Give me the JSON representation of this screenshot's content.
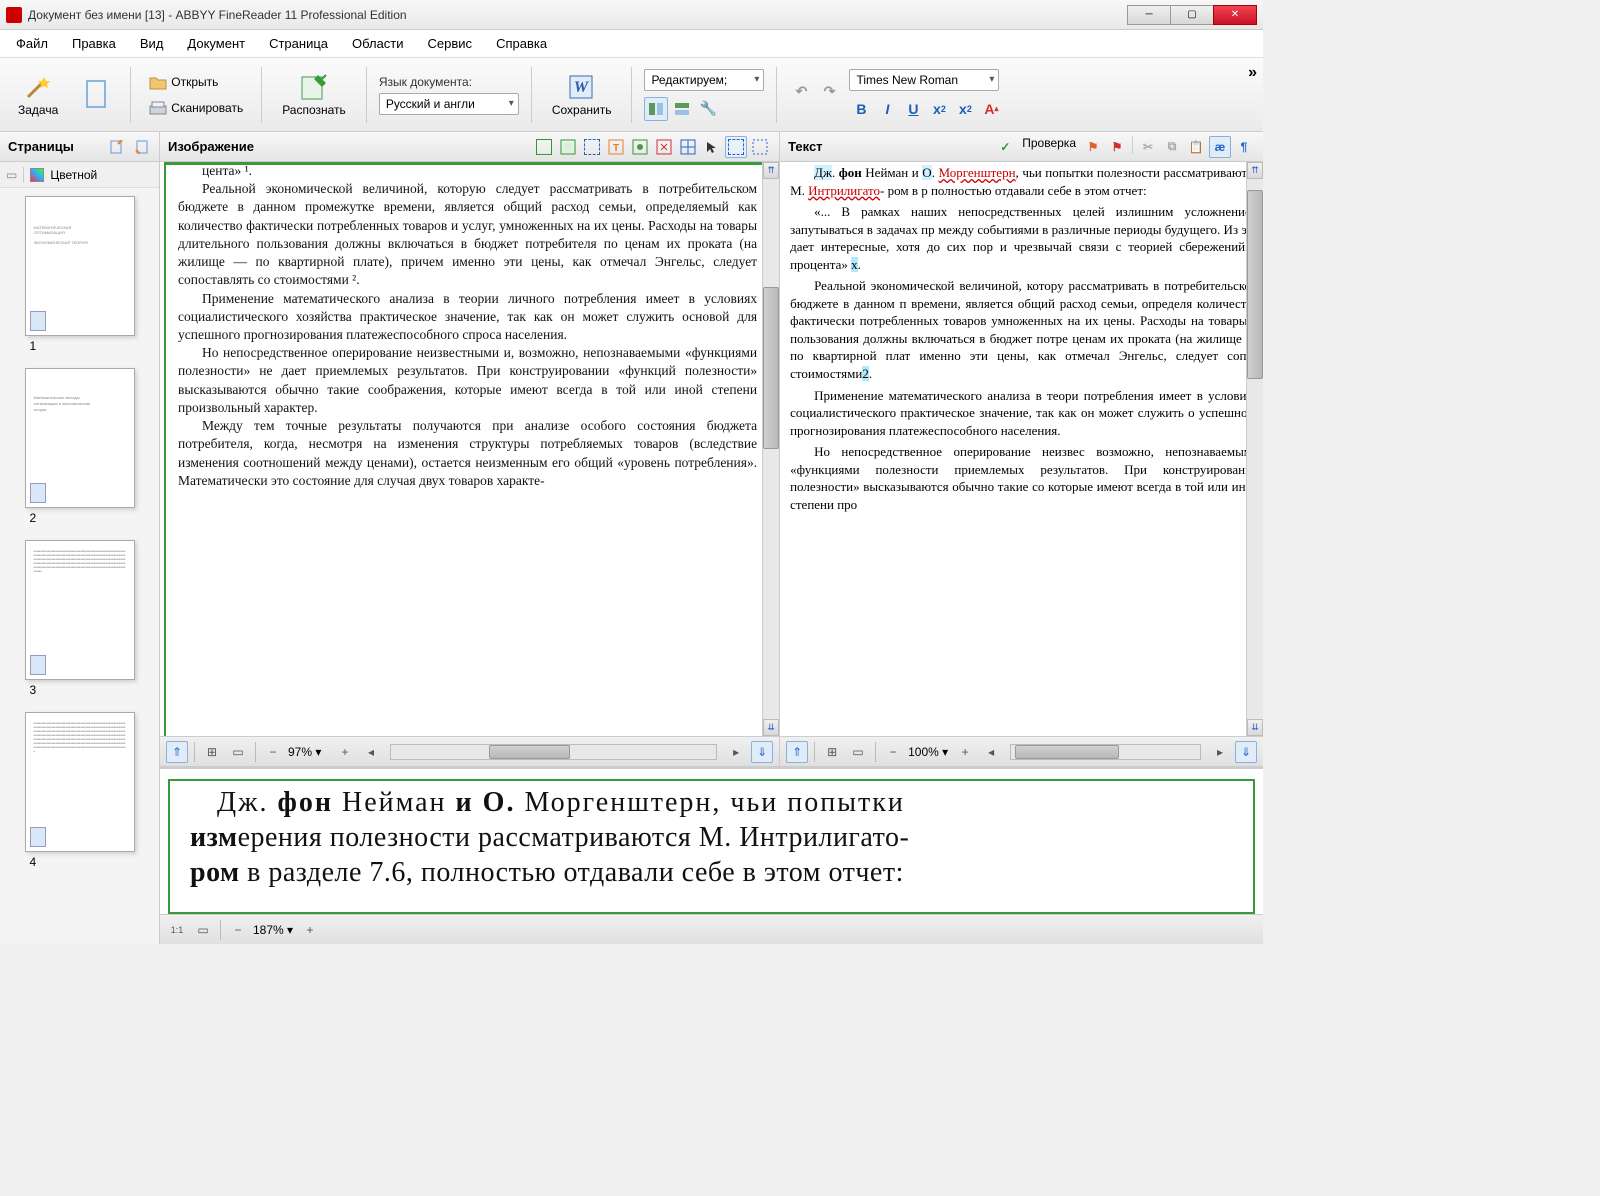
{
  "window": {
    "title": "Документ без имени [13] - ABBYY FineReader 11 Professional Edition"
  },
  "menu": [
    "Файл",
    "Правка",
    "Вид",
    "Документ",
    "Страница",
    "Области",
    "Сервис",
    "Справка"
  ],
  "toolbar": {
    "task": "Задача",
    "open": "Открыть",
    "scan": "Сканировать",
    "recognize": "Распознать",
    "lang_label": "Язык документа:",
    "lang_value": "Русский и англи",
    "save": "Сохранить",
    "edit_mode": "Редактируем;",
    "font": "Times New Roman"
  },
  "pages_panel": {
    "title": "Страницы",
    "mode": "Цветной",
    "thumbs": [
      "1",
      "2",
      "3",
      "4"
    ]
  },
  "image_panel": {
    "title": "Изображение",
    "zoom": "97%",
    "content": {
      "p0": "цента» ¹.",
      "p1": "Реальной экономической величиной, которую следует рассматривать в потребительском бюджете в данном промежутке времени, является общий расход семьи, определяемый как количество фактически потребленных товаров и услуг, умноженных на их цены. Расходы на товары длительного пользования должны включаться в бюджет потребителя по ценам их проката (на жилище — по квартирной плате), причем именно эти цены, как отмечал Энгельс, следует сопоставлять со стоимостями ².",
      "p2": "Применение математического анализа в теории личного потребления имеет в условиях социалистического хозяйства практическое значение, так как он может служить основой для успешного прогнозирования платежеспособного спроса населения.",
      "p3": "Но непосредственное оперирование неизвестными и, возможно, непознаваемыми «функциями полезности» не дает приемлемых результатов. При конструировании «функций полезности» высказываются обычно такие соображения, которые имеют всегда в той или иной степени произвольный характер.",
      "p4": "Между тем точные результаты получаются при анализе особого состояния бюджета потребителя, когда, несмотря на изменения структуры потребляемых товаров (вследствие изменения соотношений между ценами), остается неизменным его общий «уровень потребления». Математически это состояние для случая двух товаров характе-"
    }
  },
  "text_panel": {
    "title": "Текст",
    "verify": "Проверка",
    "zoom": "100%",
    "content": {
      "p1a": "Дж. фон Нейман и О. ",
      "p1b": "Моргенштерн",
      "p1c": ", чьи попытки полезности рассматриваются М. ",
      "p1d": "Интрилигато",
      "p1e": "- ром в р полностью отдавали себе в этом отчет:",
      "p2": "«... В рамках наших непосредственных целей излишним усложнением запутываться в задачах пр между событиями в различные периоды будущего. Из это дает интересные, хотя до сих пор и чрезвычай связи с теорией сбережений и процента» ",
      "p3": "Реальной экономической величиной, котору рассматривать в потребительском бюджете в данном п времени, является общий расход семьи, определя количество фактически потребленных товаров умноженных на их цены. Расходы на товары д пользования должны включаться в бюджет потре ценам их проката (на жилище — по квартирной плат именно эти цены, как отмечал Энгельс, следует сопос стоимостями",
      "p4": "Применение математического анализа в теори потребления имеет в условиях социалистического практическое значение, так как он может служить о успешного прогнозирования платежеспособного населения.",
      "p5": "Но непосредственное оперирование неизвес возможно, непознаваемыми «функциями полезности приемлемых результатов. При конструировании полезности» высказываются обычно такие со которые имеют всегда в той или иной степени про"
    }
  },
  "zoom_panel": {
    "zoom": "187%",
    "line1": "Дж. фон Нейман и О. Моргенштерн, чьи попытки",
    "line2": "измерения полезности рассматриваются М. Интрилигато-",
    "line3": "ром в разделе 7.6, полностью отдавали себе в этом отчет:"
  }
}
